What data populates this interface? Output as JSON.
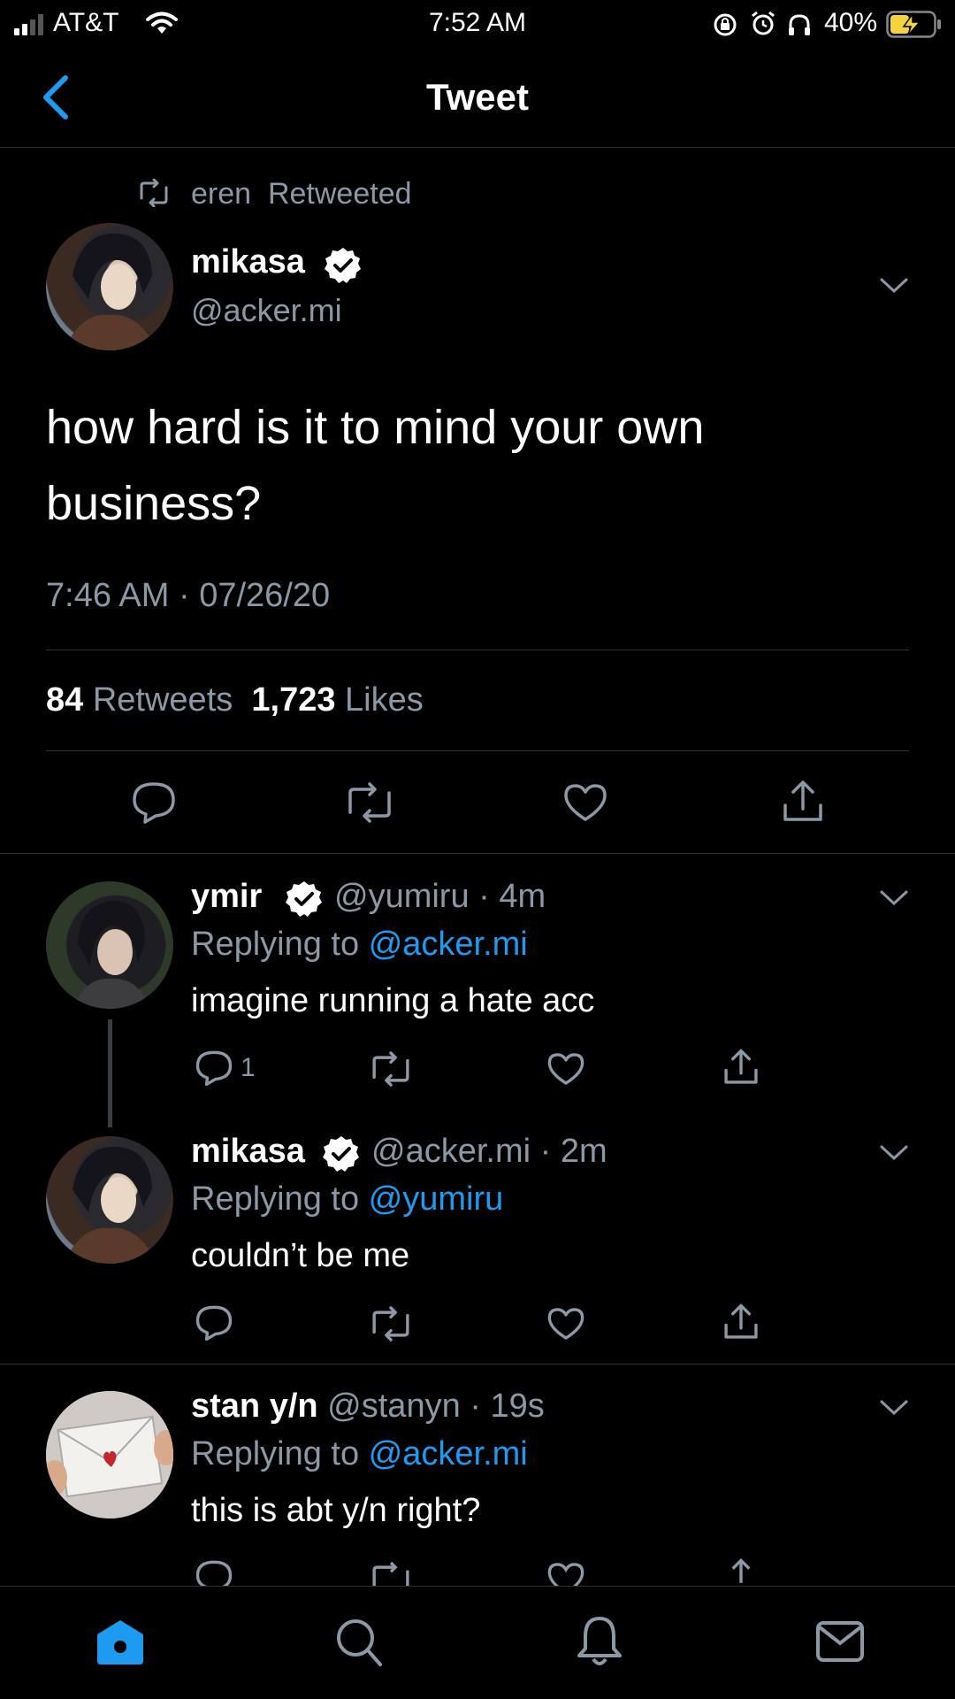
{
  "status_bar": {
    "carrier": "AT&T",
    "time": "7:52 AM",
    "battery": "40%"
  },
  "nav": {
    "title": "Tweet"
  },
  "main_tweet": {
    "retweeted_by": "eren",
    "retweeted_label": "Retweeted",
    "name": "mikasa",
    "handle": "@acker.mi",
    "verified": true,
    "text": "how hard is it to mind your own business?",
    "timestamp": "7:46 AM · 07/26/20",
    "retweets_count": "84",
    "retweets_label": "Retweets",
    "likes_count": "1,723",
    "likes_label": "Likes"
  },
  "replies": [
    {
      "name": "ymir",
      "handle": "@yumiru",
      "time": "4m",
      "verified": true,
      "replying_label": "Replying to",
      "replying_to": "@acker.mi",
      "text": "imagine running a hate acc",
      "reply_count": "1"
    },
    {
      "name": "mikasa",
      "handle": "@acker.mi",
      "time": "2m",
      "verified": true,
      "replying_label": "Replying to",
      "replying_to": "@yumiru",
      "text": "couldn’t be me",
      "reply_count": ""
    },
    {
      "name": "stan y/n",
      "handle": "@stanyn",
      "time": "19s",
      "verified": false,
      "replying_label": "Replying to",
      "replying_to": "@acker.mi",
      "text": "this is abt y/n right?",
      "reply_count": ""
    }
  ],
  "tab_bar": {
    "items": [
      "home-icon",
      "search-icon",
      "notifications-icon",
      "messages-icon"
    ],
    "active": "home-icon"
  },
  "colors": {
    "background": "#000000",
    "accent": "#1d9bf0",
    "secondary_text": "#8b98a5",
    "divider": "#2f3336",
    "battery_charging": "#f5d33a"
  }
}
